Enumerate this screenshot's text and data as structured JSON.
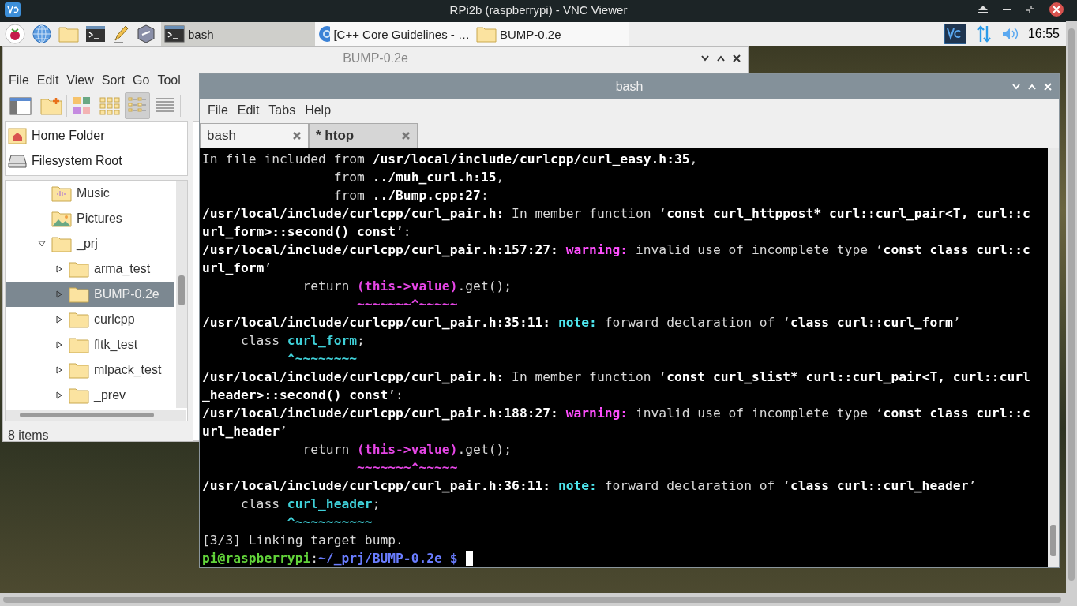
{
  "viewer": {
    "title": "RPi2b (raspberrypi) - VNC Viewer"
  },
  "taskbar": {
    "tasks": [
      {
        "label": "bash",
        "kind": "terminal",
        "selected": true
      },
      {
        "label": "[C++ Core Guidelines - …",
        "kind": "browser",
        "selected": false
      },
      {
        "label": "BUMP-0.2e",
        "kind": "folder",
        "selected": false
      }
    ],
    "clock": "16:55"
  },
  "file_manager": {
    "title": "BUMP-0.2e",
    "menu": [
      "File",
      "Edit",
      "View",
      "Sort",
      "Go",
      "Tool"
    ],
    "places": [
      {
        "label": "Home Folder",
        "kind": "home"
      },
      {
        "label": "Filesystem Root",
        "kind": "drive"
      }
    ],
    "tree": [
      {
        "label": "Music",
        "kind": "music",
        "selected": false
      },
      {
        "label": "Pictures",
        "kind": "pictures",
        "selected": false
      },
      {
        "label": "_prj",
        "kind": "folder",
        "selected": false,
        "expanded": true,
        "children": [
          {
            "label": "arma_test",
            "kind": "folder",
            "selected": false,
            "expanded": false
          },
          {
            "label": "BUMP-0.2e",
            "kind": "folder",
            "selected": true,
            "expanded": false
          },
          {
            "label": "curlcpp",
            "kind": "folder",
            "selected": false,
            "expanded": false
          },
          {
            "label": "fltk_test",
            "kind": "folder",
            "selected": false,
            "expanded": false
          },
          {
            "label": "mlpack_test",
            "kind": "folder",
            "selected": false,
            "expanded": false
          },
          {
            "label": "_prev",
            "kind": "folder",
            "selected": false,
            "expanded": false
          }
        ]
      }
    ],
    "status": "8 items"
  },
  "terminal": {
    "title": "bash",
    "menu": [
      "File",
      "Edit",
      "Tabs",
      "Help"
    ],
    "tabs": [
      {
        "label": "bash",
        "selected": true,
        "activity": false
      },
      {
        "label": "* htop",
        "selected": false,
        "activity": true
      }
    ],
    "lines": [
      [
        {
          "text": "In file included from ",
          "kind": "plain"
        },
        {
          "text": "/usr/local/include/curlcpp/curl_easy.h:35",
          "kind": "bold"
        },
        {
          "text": ",",
          "kind": "plain"
        }
      ],
      [
        {
          "text": "                 from ",
          "kind": "plain"
        },
        {
          "text": "../muh_curl.h:15",
          "kind": "bold"
        },
        {
          "text": ",",
          "kind": "plain"
        }
      ],
      [
        {
          "text": "                 from ",
          "kind": "plain"
        },
        {
          "text": "../Bump.cpp:27",
          "kind": "bold"
        },
        {
          "text": ":",
          "kind": "plain"
        }
      ],
      [
        {
          "text": "/usr/local/include/curlcpp/curl_pair.h:",
          "kind": "bold"
        },
        {
          "text": " In member function ‘",
          "kind": "plain"
        },
        {
          "text": "const curl_httppost* curl::curl_pair<T, curl::c",
          "kind": "bold"
        }
      ],
      [
        {
          "text": "url_form>::second() const",
          "kind": "bold"
        },
        {
          "text": "’:",
          "kind": "plain"
        }
      ],
      [
        {
          "text": "/usr/local/include/curlcpp/curl_pair.h:157:27: ",
          "kind": "bold"
        },
        {
          "text": "warning:",
          "kind": "warning"
        },
        {
          "text": " invalid use of incomplete type ‘",
          "kind": "plain"
        },
        {
          "text": "const class curl::c",
          "kind": "bold"
        }
      ],
      [
        {
          "text": "url_form",
          "kind": "bold"
        },
        {
          "text": "’",
          "kind": "plain"
        }
      ],
      [
        {
          "text": "             return ",
          "kind": "plain"
        },
        {
          "text": "(this->value)",
          "kind": "magenta"
        },
        {
          "text": ".get();",
          "kind": "plain"
        }
      ],
      [
        {
          "text": "                    ~~~~~~~^~~~~~",
          "kind": "magenta"
        }
      ],
      [
        {
          "text": "/usr/local/include/curlcpp/curl_pair.h:35:11: ",
          "kind": "bold"
        },
        {
          "text": "note:",
          "kind": "note"
        },
        {
          "text": " forward declaration of ‘",
          "kind": "plain"
        },
        {
          "text": "class curl::curl_form",
          "kind": "bold"
        },
        {
          "text": "’",
          "kind": "plain"
        }
      ],
      [
        {
          "text": "     class ",
          "kind": "plain"
        },
        {
          "text": "curl_form",
          "kind": "cyan"
        },
        {
          "text": ";",
          "kind": "plain"
        }
      ],
      [
        {
          "text": "           ^~~~~~~~~",
          "kind": "cyan"
        }
      ],
      [
        {
          "text": "/usr/local/include/curlcpp/curl_pair.h:",
          "kind": "bold"
        },
        {
          "text": " In member function ‘",
          "kind": "plain"
        },
        {
          "text": "const curl_slist* curl::curl_pair<T, curl::curl",
          "kind": "bold"
        }
      ],
      [
        {
          "text": "_header>::second() const",
          "kind": "bold"
        },
        {
          "text": "’:",
          "kind": "plain"
        }
      ],
      [
        {
          "text": "/usr/local/include/curlcpp/curl_pair.h:188:27: ",
          "kind": "bold"
        },
        {
          "text": "warning:",
          "kind": "warning"
        },
        {
          "text": " invalid use of incomplete type ‘",
          "kind": "plain"
        },
        {
          "text": "const class curl::c",
          "kind": "bold"
        }
      ],
      [
        {
          "text": "url_header",
          "kind": "bold"
        },
        {
          "text": "’",
          "kind": "plain"
        }
      ],
      [
        {
          "text": "             return ",
          "kind": "plain"
        },
        {
          "text": "(this->value)",
          "kind": "magenta"
        },
        {
          "text": ".get();",
          "kind": "plain"
        }
      ],
      [
        {
          "text": "                    ~~~~~~~^~~~~~",
          "kind": "magenta"
        }
      ],
      [
        {
          "text": "/usr/local/include/curlcpp/curl_pair.h:36:11: ",
          "kind": "bold"
        },
        {
          "text": "note:",
          "kind": "note"
        },
        {
          "text": " forward declaration of ‘",
          "kind": "plain"
        },
        {
          "text": "class curl::curl_header",
          "kind": "bold"
        },
        {
          "text": "’",
          "kind": "plain"
        }
      ],
      [
        {
          "text": "     class ",
          "kind": "plain"
        },
        {
          "text": "curl_header",
          "kind": "cyan"
        },
        {
          "text": ";",
          "kind": "plain"
        }
      ],
      [
        {
          "text": "           ^~~~~~~~~~~",
          "kind": "cyan"
        }
      ],
      [
        {
          "text": "[3/3] Linking target bump.",
          "kind": "plain"
        }
      ],
      [
        {
          "text": "pi@raspberrypi",
          "kind": "user"
        },
        {
          "text": ":",
          "kind": "plain"
        },
        {
          "text": "~/_prj/BUMP-0.2e $",
          "kind": "path"
        }
      ]
    ]
  }
}
